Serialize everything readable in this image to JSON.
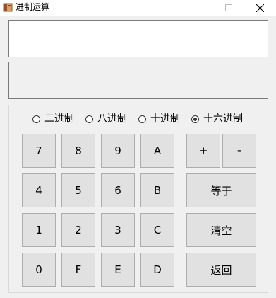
{
  "window": {
    "title": "进制运算",
    "minimize_glyph": "–",
    "maximize_glyph": "☐",
    "close_glyph": "✕",
    "icon": "app-icon"
  },
  "fields": {
    "input_value": "",
    "result_value": ""
  },
  "radix": {
    "options": [
      {
        "label": "二进制",
        "checked": false
      },
      {
        "label": "八进制",
        "checked": false
      },
      {
        "label": "十进制",
        "checked": false
      },
      {
        "label": "十六进制",
        "checked": true
      }
    ]
  },
  "keys": {
    "k7": "7",
    "k8": "8",
    "k9": "9",
    "kA": "A",
    "k4": "4",
    "k5": "5",
    "k6": "6",
    "kB": "B",
    "k1": "1",
    "k2": "2",
    "k3": "3",
    "kC": "C",
    "k0": "0",
    "kF": "F",
    "kE": "E",
    "kD": "D",
    "plus": "+",
    "minus": "-",
    "equals": "等于",
    "clear": "清空",
    "back": "返回"
  }
}
